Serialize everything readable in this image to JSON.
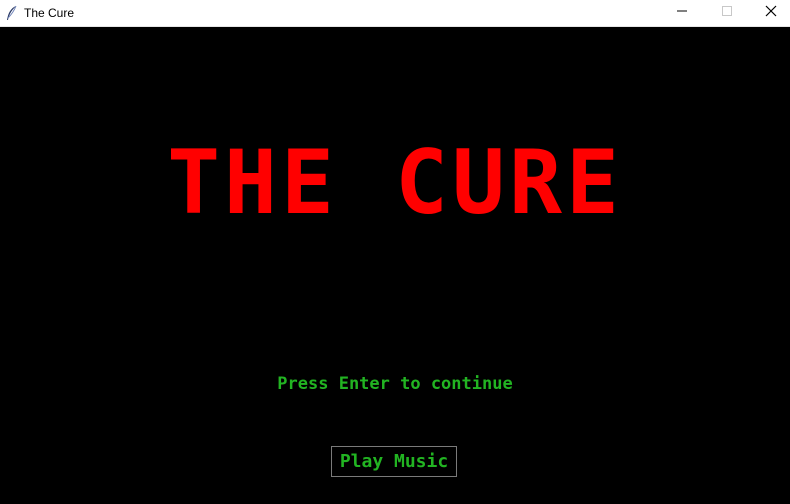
{
  "window": {
    "title": "The Cure",
    "icon": "feather-icon",
    "controls": {
      "minimize_icon": "minimize-icon",
      "maximize_icon": "maximize-icon",
      "close_icon": "close-icon"
    }
  },
  "screen": {
    "title": "THE CURE",
    "prompt": "Press Enter to continue",
    "play_music_label": "Play Music"
  },
  "colors": {
    "background": "#000000",
    "title": "#ff0000",
    "text": "#22b422",
    "button_border": "#7a7a7a"
  }
}
